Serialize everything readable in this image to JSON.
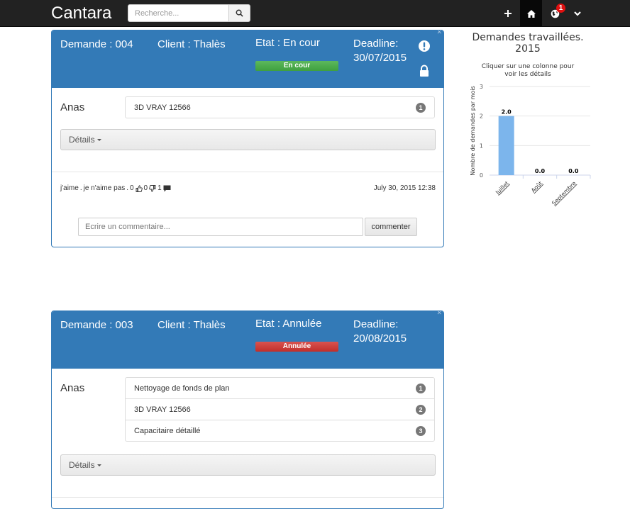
{
  "navbar": {
    "brand": "Cantara",
    "search_placeholder": "Recherche...",
    "icons": [
      "plus-icon",
      "home-icon",
      "globe-icon",
      "chevron-down-icon"
    ],
    "notification_count": "1"
  },
  "requests": [
    {
      "id_label": "Demande : 004",
      "client_label": "Client : Thalès",
      "state_label": "Etat : En cour",
      "status_badge": "En cour",
      "status_color": "#4cae4c",
      "deadline_label": "Deadline:",
      "deadline_date": "30/07/2015",
      "assignee": "Anas",
      "tasks": [
        {
          "name": "3D VRAY 12566",
          "count": "1"
        }
      ],
      "details_label": "Détails",
      "social": {
        "like": "j'aime",
        "sep1": ".",
        "dislike": "je n'aime pas",
        "sep2": ".",
        "likes": "0",
        "dislikes": "0",
        "comments": "1"
      },
      "timestamp": "July 30, 2015 12:38",
      "comment_placeholder": "Ecrire un commentaire...",
      "comment_button": "commenter"
    },
    {
      "id_label": "Demande : 003",
      "client_label": "Client : Thalès",
      "state_label": "Etat : Annulée",
      "status_badge": "Annulée",
      "status_color": "#d43f3a",
      "deadline_label": "Deadline:",
      "deadline_date": "20/08/2015",
      "assignee": "Anas",
      "tasks": [
        {
          "name": "Nettoyage de fonds de plan",
          "count": "1"
        },
        {
          "name": "3D VRAY 12566",
          "count": "2"
        },
        {
          "name": "Capacitaire détaillé",
          "count": "3"
        }
      ],
      "details_label": "Détails"
    }
  ],
  "chart": {
    "title_line1": "Demandes travaillées.",
    "title_line2": "2015",
    "subtitle_line1": "Cliquer sur une colonne pour",
    "subtitle_line2": "voir les détails"
  },
  "chart_data": {
    "type": "bar",
    "title": "Demandes travaillées. 2015",
    "subtitle": "Cliquer sur une colonne pour voir les détails",
    "categories": [
      "Juillet",
      "Août",
      "Septembre"
    ],
    "values": [
      2.0,
      0.0,
      0.0
    ],
    "data_labels": [
      "2.0",
      "0.0",
      "0.0"
    ],
    "ylabel": "Nombre de demandes par mois",
    "ylim": [
      0,
      3
    ],
    "yticks": [
      "0",
      "1",
      "2",
      "3"
    ],
    "bar_color": "#7cb5ec",
    "grid": true
  }
}
